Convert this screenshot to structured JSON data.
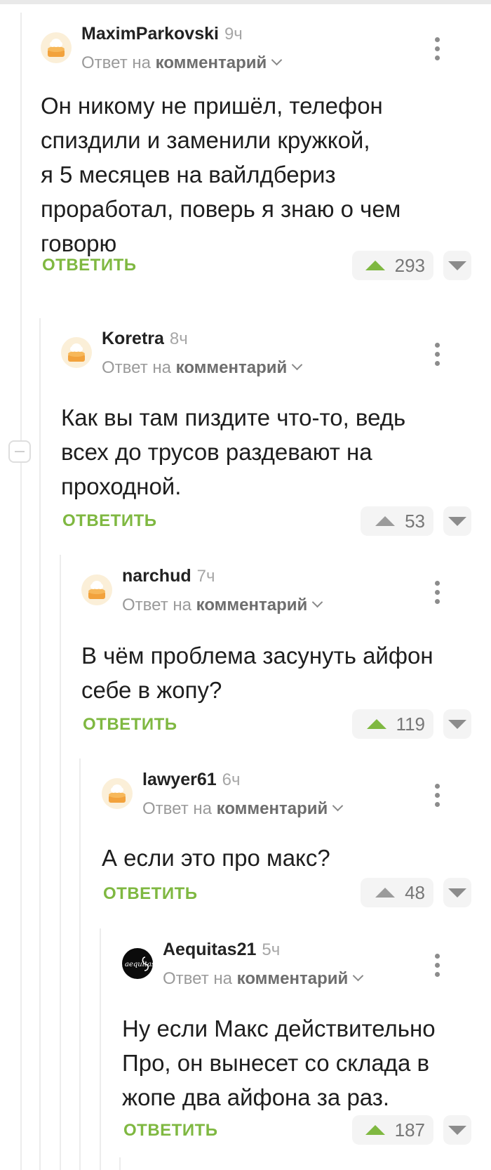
{
  "ui": {
    "reply_prefix": "Ответ на",
    "reply_target": "комментарий",
    "reply_button": "ОТВЕТИТЬ"
  },
  "colors": {
    "accent_green": "#7fb841",
    "muted_text": "#9a9a9a",
    "rating_bg": "#f4f4f4"
  },
  "comments": [
    {
      "user": "MaximParkovski",
      "time": "9ч",
      "avatar": "default-cook-avatar",
      "text": "Он никому не пришёл, телефон\nспиздили и заменили кружкой,\nя 5 месяцев на вайлдбериз\nпроработал, поверь я знаю о чем\nговорю",
      "rating": "293",
      "voted_up": true
    },
    {
      "user": "Koretra",
      "time": "8ч",
      "avatar": "default-cook-avatar",
      "text": "Как вы там пиздите что-то, ведь\nвсех до трусов раздевают на\nпроходной.",
      "rating": "53",
      "voted_up": false
    },
    {
      "user": "narchud",
      "time": "7ч",
      "avatar": "default-cook-avatar",
      "text": "В чём проблема засунуть айфон\nсебе в жопу?",
      "rating": "119",
      "voted_up": true
    },
    {
      "user": "lawyer61",
      "time": "6ч",
      "avatar": "default-cook-avatar",
      "text": "А если это про макс?",
      "rating": "48",
      "voted_up": false
    },
    {
      "user": "Aequitas21",
      "time": "5ч",
      "avatar": "aequitas-logo-avatar",
      "avatar_text": "aequitas",
      "text": "Ну если Макс действительно\nПро, он вынесет со склада в\nжопе два айфона за раз.",
      "rating": "187",
      "voted_up": true
    }
  ]
}
